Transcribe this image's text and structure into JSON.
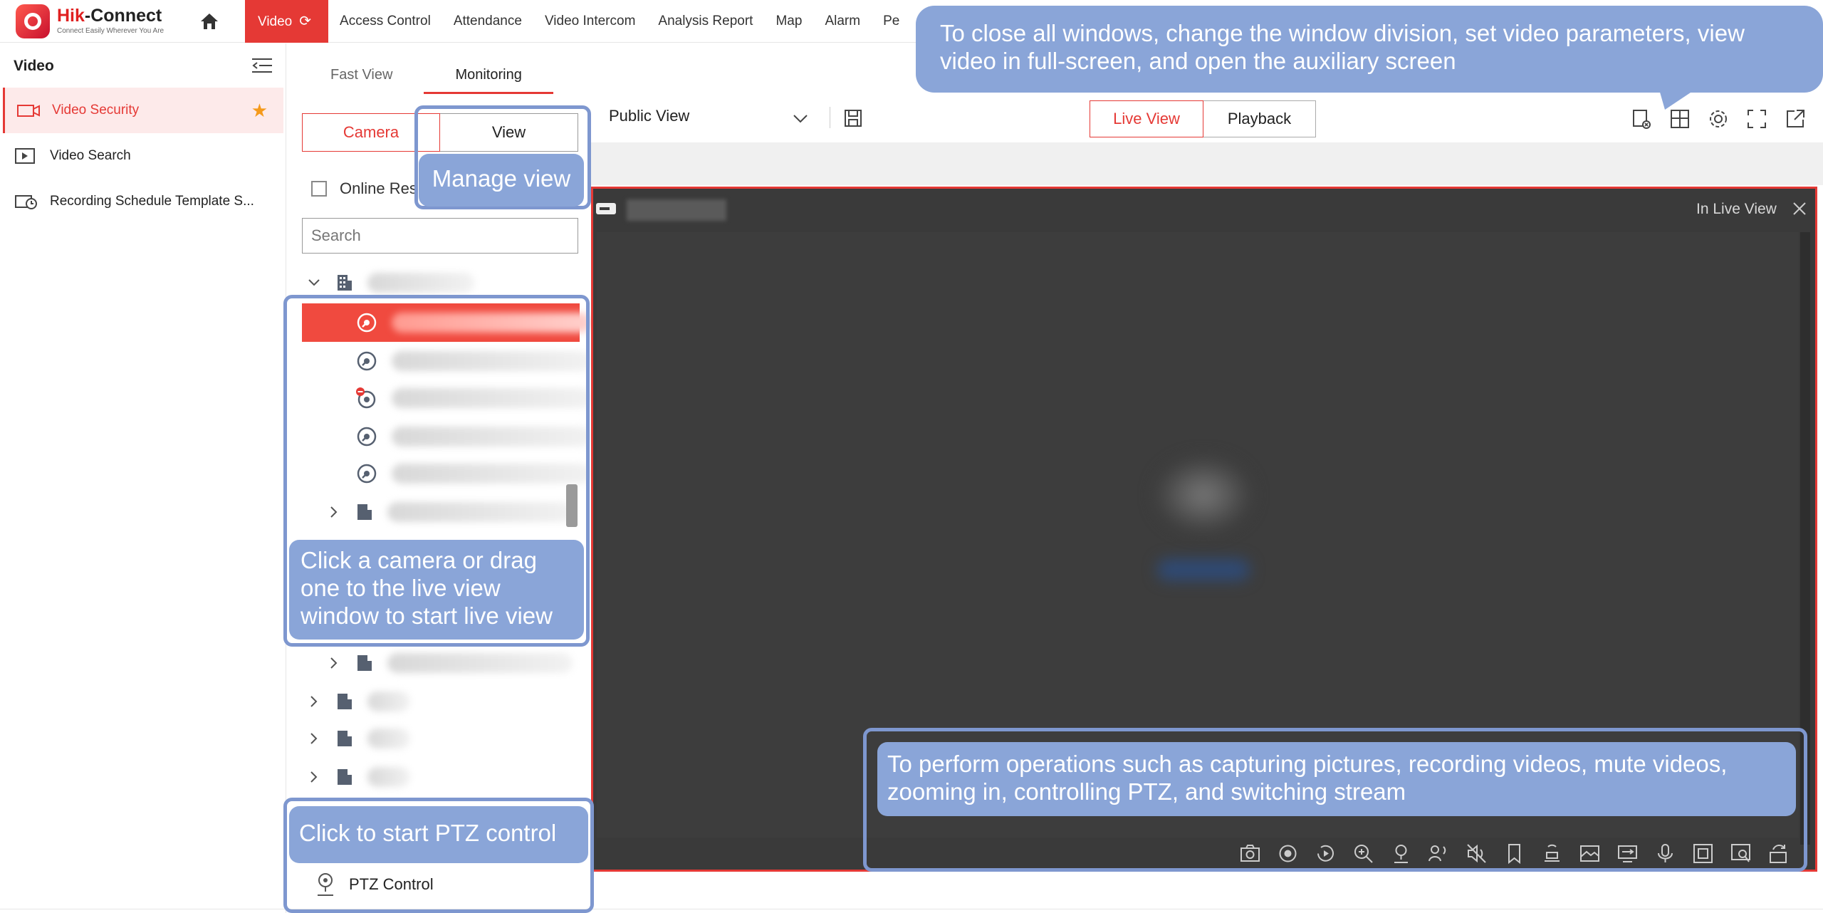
{
  "app": {
    "brand_prefix": "Hik",
    "brand_suffix": "-Connect",
    "tagline": "Connect Easily Wherever You Are"
  },
  "nav": {
    "items": [
      "Video",
      "Access Control",
      "Attendance",
      "Video Intercom",
      "Analysis Report",
      "Map",
      "Alarm",
      "Pe"
    ],
    "active_index": 0
  },
  "sidebar": {
    "title": "Video",
    "items": [
      {
        "label": "Video Security",
        "active": true,
        "favorite": true
      },
      {
        "label": "Video Search",
        "active": false
      },
      {
        "label": "Recording Schedule Template S..."
      }
    ]
  },
  "panel": {
    "tabs": [
      "Fast View",
      "Monitoring"
    ],
    "active_tab": 1,
    "segments": [
      "Camera",
      "View"
    ],
    "online_label": "Online Res",
    "search_placeholder": "Search",
    "ptz_label": "PTZ Control"
  },
  "toolbar": {
    "view_select": "Public View",
    "modes": [
      "Live View",
      "Playback"
    ],
    "active_mode": 0
  },
  "liveview": {
    "status": "In Live View"
  },
  "callouts": {
    "top": "To close all windows, change the window division, set video parameters, view video in full-screen, and open the auxiliary screen",
    "manage": "Manage view",
    "click_camera": "Click a camera or drag one to the live view window to start live view",
    "ops": "To perform operations such as capturing pictures, recording videos, mute videos, zooming in, controlling PTZ, and switching stream",
    "ptz": "Click to start PTZ control"
  },
  "colors": {
    "accent": "#e53935",
    "callout": "#8aa5d8",
    "callout_border": "#7e97cf",
    "favorite": "#f59a1b"
  }
}
